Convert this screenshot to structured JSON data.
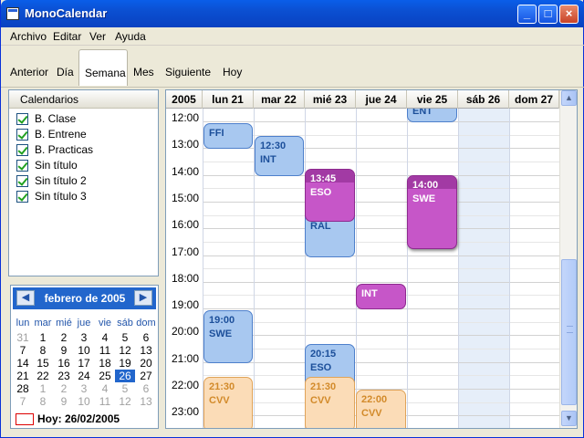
{
  "window": {
    "title": "MonoCalendar",
    "minimize": "_",
    "maximize": "□",
    "close": "×"
  },
  "menu": [
    "Archivo",
    "Editar",
    "Ver",
    "Ayuda"
  ],
  "toolbar": {
    "anterior": "Anterior",
    "dia": "Día",
    "semana": "Semana",
    "mes": "Mes",
    "siguiente": "Siguiente",
    "hoy": "Hoy"
  },
  "calendars": {
    "header": "Calendarios",
    "items": [
      "B. Clase",
      "B. Entrene",
      "B. Practicas",
      "Sin título",
      "Sin título 2",
      "Sin título 3"
    ]
  },
  "minical": {
    "title": "febrero de 2005",
    "prev": "◀",
    "next": "▶",
    "dow": [
      "lun",
      "mar",
      "mié",
      "jue",
      "vie",
      "sáb",
      "dom"
    ],
    "weeks": [
      [
        "31",
        "1",
        "2",
        "3",
        "4",
        "5",
        "6"
      ],
      [
        "7",
        "8",
        "9",
        "10",
        "11",
        "12",
        "13"
      ],
      [
        "14",
        "15",
        "16",
        "17",
        "18",
        "19",
        "20"
      ],
      [
        "21",
        "22",
        "23",
        "24",
        "25",
        "26",
        "27"
      ],
      [
        "28",
        "1",
        "2",
        "3",
        "4",
        "5",
        "6"
      ],
      [
        "7",
        "8",
        "9",
        "10",
        "11",
        "12",
        "13"
      ]
    ],
    "today_label": "Hoy: 26/02/2005",
    "selected_day": "26"
  },
  "week": {
    "year": "2005",
    "days": [
      "lun 21",
      "mar 22",
      "mié 23",
      "jue 24",
      "vie 25",
      "sáb 26",
      "dom 27"
    ],
    "hours": [
      "12:00",
      "13:00",
      "14:00",
      "15:00",
      "16:00",
      "17:00",
      "18:00",
      "19:00",
      "20:00",
      "21:00",
      "22:00",
      "23:00"
    ]
  },
  "events": {
    "e_top": {
      "title": "ENT"
    },
    "e_ffi": {
      "title": "FFI"
    },
    "e_int1": {
      "time": "12:30",
      "title": "INT"
    },
    "e_eso1": {
      "time": "13:45",
      "title": "ESO"
    },
    "e_ral": {
      "title": "RAL"
    },
    "e_swe1": {
      "time": "14:00",
      "title": "SWE"
    },
    "e_int2": {
      "title": "INT"
    },
    "e_swe2": {
      "time": "19:00",
      "title": "SWE"
    },
    "e_eso2": {
      "time": "20:15",
      "title": "ESO"
    },
    "e_cvv1": {
      "time": "21:30",
      "title": "CVV"
    },
    "e_cvv2": {
      "time": "21:30",
      "title": "CVV"
    },
    "e_cvv3": {
      "time": "22:00",
      "title": "CVV"
    }
  },
  "colors": {
    "blue_event": "#a8c8f0",
    "purple_event": "#c656c8",
    "orange_event": "#fbdcb7",
    "titlebar": "#0a5ee9"
  },
  "icons": {
    "app": "calendar-app-icon",
    "scroll_up": "scroll-up-arrow-icon",
    "scroll_down": "scroll-down-arrow-icon"
  }
}
